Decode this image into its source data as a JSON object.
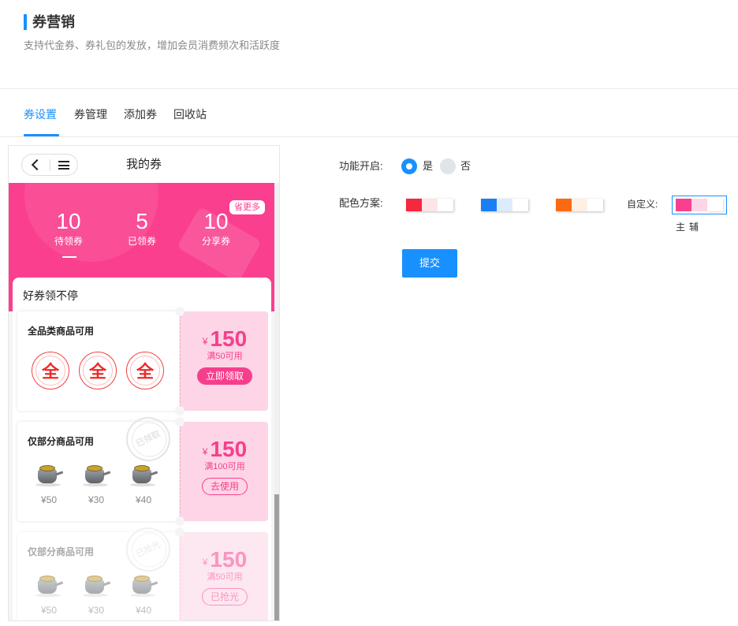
{
  "header": {
    "title": "券营销",
    "subtitle": "支持代金券、券礼包的发放，增加会员消费频次和活跃度"
  },
  "tabs": [
    {
      "label": "券设置",
      "active": true
    },
    {
      "label": "券管理",
      "active": false
    },
    {
      "label": "添加券",
      "active": false
    },
    {
      "label": "回收站",
      "active": false
    }
  ],
  "phone": {
    "title": "我的券",
    "stats": [
      {
        "num": "10",
        "label": "待领券"
      },
      {
        "num": "5",
        "label": "已领券"
      },
      {
        "num": "10",
        "label": "分享券"
      }
    ],
    "more_badge": "省更多",
    "section_title": "好券领不停",
    "coupons": [
      {
        "condition": "全品类商品可用",
        "icon_text": [
          "全",
          "全",
          "全"
        ],
        "yen": "¥",
        "amount": "150",
        "threshold": "满50可用",
        "button": "立即领取",
        "state": "claimable"
      },
      {
        "condition": "仅部分商品可用",
        "products": [
          "¥50",
          "¥30",
          "¥40"
        ],
        "yen": "¥",
        "amount": "150",
        "threshold": "满100可用",
        "button": "去使用",
        "stamp": "已领取",
        "state": "claimed"
      },
      {
        "condition": "仅部分商品可用",
        "products": [
          "¥50",
          "¥30",
          "¥40"
        ],
        "yen": "¥",
        "amount": "150",
        "threshold": "满50可用",
        "button": "已抢光",
        "stamp": "已抢光",
        "state": "sold-out"
      }
    ]
  },
  "settings": {
    "enable_label": "功能开启:",
    "enable_yes": "是",
    "enable_no": "否",
    "enabled": true,
    "color_label": "配色方案:",
    "presets": [
      {
        "main": "#f5283c",
        "aux": "#fde4e6"
      },
      {
        "main": "#1a7ff5",
        "aux": "#dcecfd"
      },
      {
        "main": "#fb6a10",
        "aux": "#fff0e4"
      }
    ],
    "custom_label": "自定义:",
    "custom": {
      "main": "#fa3f8f",
      "aux": "#fdd5e6"
    },
    "custom_main_label": "主",
    "custom_aux_label": "辅",
    "submit": "提交"
  }
}
